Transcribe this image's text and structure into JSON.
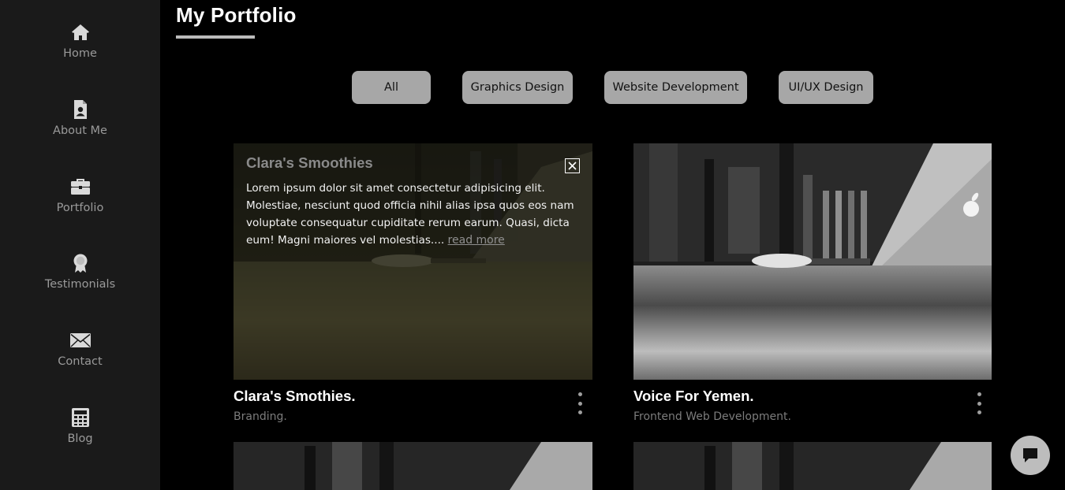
{
  "sidebar": {
    "items": [
      {
        "label": "Home",
        "icon": "home-icon"
      },
      {
        "label": "About Me",
        "icon": "profile-document-icon"
      },
      {
        "label": "Portfolio",
        "icon": "briefcase-icon"
      },
      {
        "label": "Testimonials",
        "icon": "award-ribbon-icon"
      },
      {
        "label": "Contact",
        "icon": "envelope-icon"
      },
      {
        "label": "Blog",
        "icon": "calculator-icon"
      }
    ]
  },
  "header": {
    "title": "My Portfolio"
  },
  "filters": [
    "All",
    "Graphics Design",
    "Website Development",
    "UI/UX Design"
  ],
  "cards": [
    {
      "title": "Clara's Smothies.",
      "subtitle": "Branding.",
      "overlay": {
        "title": "Clara's Smoothies",
        "text": "Lorem ipsum dolor sit amet consectetur adipisicing elit. Molestiae, nesciunt quod officia nihil alias ipsa quos eos nam voluptate consequatur cupiditate rerum earum. Quasi, dicta eum! Magni maiores vel molestias....",
        "read_more": "read more"
      }
    },
    {
      "title": "Voice For Yemen.",
      "subtitle": "Frontend Web Development."
    }
  ],
  "colors": {
    "sidebar_bg": "#1a1a1a",
    "page_bg": "#000000",
    "filter_bg": "#a7a7a7",
    "muted_text": "#7c7c7c"
  }
}
